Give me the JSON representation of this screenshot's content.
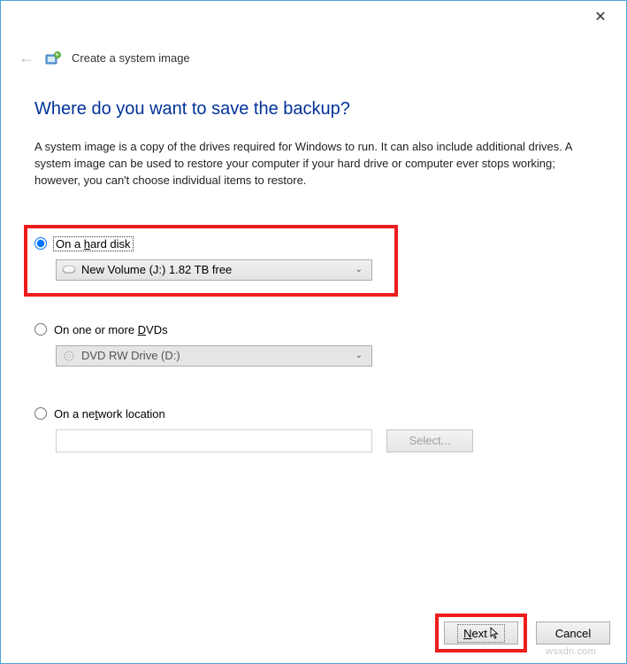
{
  "titlebar": {
    "close_glyph": "✕"
  },
  "header": {
    "back_glyph": "←",
    "app_title": "Create a system image"
  },
  "page": {
    "heading": "Where do you want to save the backup?",
    "description": "A system image is a copy of the drives required for Windows to run. It can also include additional drives. A system image can be used to restore your computer if your hard drive or computer ever stops working; however, you can't choose individual items to restore."
  },
  "options": {
    "hard_disk": {
      "label_pre": "On a ",
      "label_u": "h",
      "label_post": "ard disk",
      "selected_drive": "New Volume (J:)  1.82 TB free"
    },
    "dvd": {
      "label_pre": "On one or more ",
      "label_u": "D",
      "label_post": "VDs",
      "selected_drive": "DVD RW Drive (D:)"
    },
    "network": {
      "label_pre": "On a ne",
      "label_u": "t",
      "label_post": "work location",
      "select_button": "Select..."
    }
  },
  "footer": {
    "next_u": "N",
    "next_post": "ext",
    "cancel": "Cancel"
  },
  "watermark": "wsxdn.com"
}
